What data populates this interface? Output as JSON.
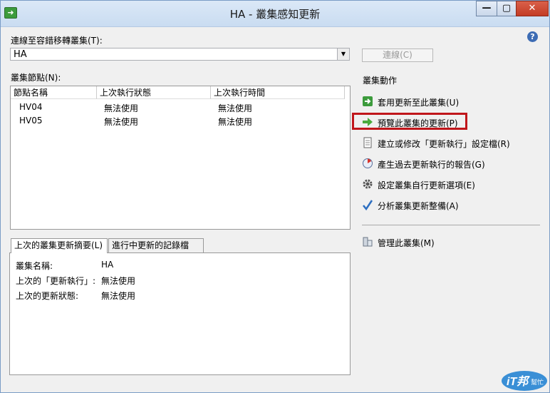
{
  "window": {
    "title": "HA - 叢集感知更新",
    "minimize_glyph": "—",
    "maximize_glyph": "▢",
    "close_glyph": "✕",
    "app_icon": "cluster-update-icon"
  },
  "help_icon": "?",
  "connect": {
    "label": "連線至容錯移轉叢集(T):",
    "combo_value": "HA",
    "button_label": "連線(C)"
  },
  "nodes": {
    "label": "叢集節點(N):",
    "columns": [
      "節點名稱",
      "上次執行狀態",
      "上次執行時間"
    ],
    "rows": [
      [
        "HV04",
        "無法使用",
        "無法使用"
      ],
      [
        "HV05",
        "無法使用",
        "無法使用"
      ]
    ]
  },
  "tabs": [
    {
      "label": "上次的叢集更新摘要(L)",
      "active": true
    },
    {
      "label": "進行中更新的記錄檔(O)",
      "active": false
    }
  ],
  "summary": [
    {
      "label": "叢集名稱:",
      "value": "HA"
    },
    {
      "label": "上次的「更新執行」:",
      "value": "無法使用"
    },
    {
      "label": "上次的更新狀態:",
      "value": "無法使用"
    }
  ],
  "actions": {
    "title": "叢集動作",
    "items": [
      {
        "label": "套用更新至此叢集(U)",
        "icon": "apply-updates-icon"
      },
      {
        "label": "預覽此叢集的更新(P)",
        "icon": "preview-arrow-icon",
        "highlighted": true
      },
      {
        "label": "建立或修改「更新執行」設定檔(R)",
        "icon": "document-icon"
      },
      {
        "label": "產生過去更新執行的報告(G)",
        "icon": "report-icon"
      },
      {
        "label": "設定叢集自行更新選項(E)",
        "icon": "gear-icon"
      },
      {
        "label": "分析叢集更新整備(A)",
        "icon": "checkmark-icon"
      }
    ],
    "manage_label": "管理此叢集(M)",
    "manage_icon": "manage-cluster-icon"
  },
  "watermark": {
    "logo_text": "iT邦",
    "sub_text": "幫忙"
  },
  "colors": {
    "highlight": "#c0161b",
    "accent_green": "#3c9b3c",
    "help_blue": "#3d6cb4"
  }
}
